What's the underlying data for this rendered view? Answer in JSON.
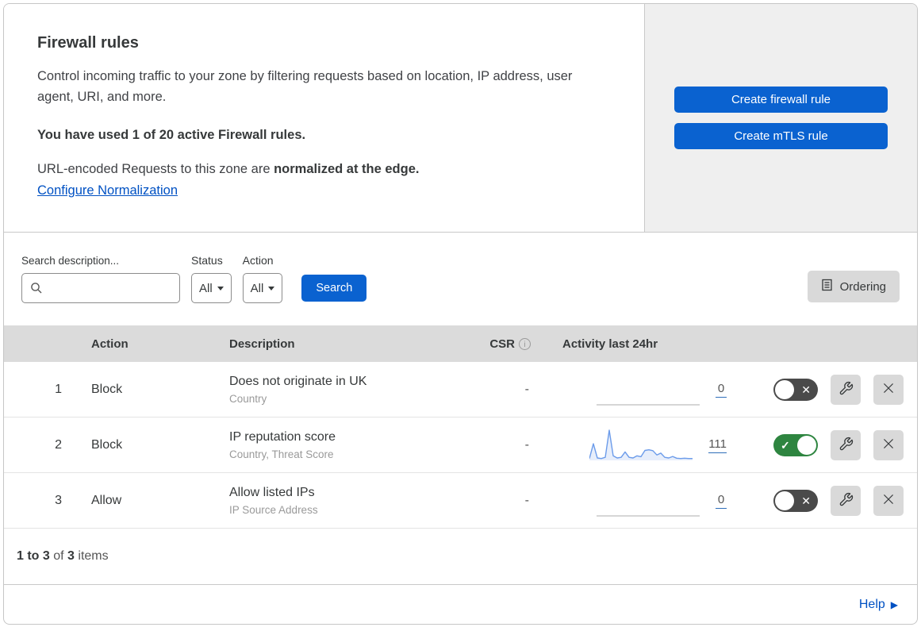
{
  "header": {
    "title": "Firewall rules",
    "description": "Control incoming traffic to your zone by filtering requests based on location, IP address, user agent, URI, and more.",
    "usage_text": "You have used 1 of 20 active Firewall rules.",
    "normalization_prefix": "URL-encoded Requests to this zone are ",
    "normalization_bold": "normalized at the edge.",
    "normalization_link": "Configure Normalization"
  },
  "actions_panel": {
    "create_firewall_label": "Create firewall rule",
    "create_mtls_label": "Create mTLS rule"
  },
  "filters": {
    "search_label": "Search description...",
    "search_value": "",
    "status_label": "Status",
    "status_value": "All",
    "action_label": "Action",
    "action_value": "All",
    "search_button_label": "Search",
    "ordering_button_label": "Ordering"
  },
  "table": {
    "columns": {
      "action": "Action",
      "description": "Description",
      "csr": "CSR",
      "activity": "Activity last 24hr"
    },
    "rows": [
      {
        "index": "1",
        "action": "Block",
        "description": "Does not originate in UK",
        "criteria": "Country",
        "csr": "-",
        "activity_count": "0",
        "enabled": false,
        "sparkline": []
      },
      {
        "index": "2",
        "action": "Block",
        "description": "IP reputation score",
        "criteria": "Country, Threat Score",
        "csr": "-",
        "activity_count": "111",
        "enabled": true,
        "sparkline": [
          6,
          55,
          8,
          6,
          10,
          100,
          15,
          8,
          10,
          28,
          10,
          8,
          15,
          12,
          33,
          35,
          32,
          18,
          24,
          10,
          8,
          13,
          7,
          6,
          7,
          6,
          6
        ]
      },
      {
        "index": "3",
        "action": "Allow",
        "description": "Allow listed IPs",
        "criteria": "IP Source Address",
        "csr": "-",
        "activity_count": "0",
        "enabled": false,
        "sparkline": []
      }
    ]
  },
  "footer": {
    "range_text": "1 to 3",
    "of_text": " of ",
    "total_text": "3",
    "items_text": " items",
    "help_label": "Help"
  },
  "colors": {
    "primary_blue": "#0a62d0",
    "link_blue": "#0051c3",
    "toggle_on_green": "#2e8540",
    "toggle_off_gray": "#4a4a4a",
    "table_header_gray": "#dbdbdb",
    "side_panel_gray": "#efefef",
    "icon_button_gray": "#d9d9d9",
    "sparkline_blue": "#6b9bea"
  }
}
